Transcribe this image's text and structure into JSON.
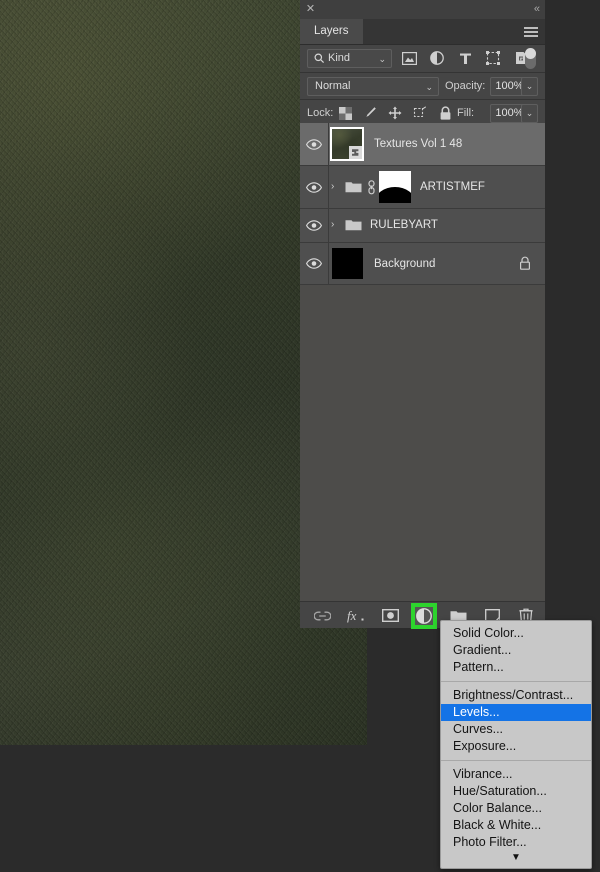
{
  "panel": {
    "close_icon": "close-icon",
    "collapse_icon": "collapse-icon",
    "tab_label": "Layers",
    "menu_icon": "panel-menu-icon"
  },
  "filter_row": {
    "kind_label": "Kind",
    "kind_arrow": "⌄",
    "icons": [
      {
        "name": "pixel-layer-filter-icon",
        "title": "Pixel layers"
      },
      {
        "name": "adjustment-layer-filter-icon",
        "title": "Adjustment layers"
      },
      {
        "name": "type-layer-filter-icon",
        "title": "Type layers"
      },
      {
        "name": "shape-layer-filter-icon",
        "title": "Shape layers"
      },
      {
        "name": "smart-object-filter-icon",
        "title": "Smart objects"
      }
    ],
    "toggle_name": "filter-enable-toggle"
  },
  "blend_row": {
    "blend_mode": "Normal",
    "blend_arrow": "⌄",
    "opacity_label": "Opacity:",
    "opacity_value": "100%",
    "opacity_arrow": "⌄"
  },
  "lock_row": {
    "lock_label": "Lock:",
    "icons": [
      {
        "name": "lock-transparent-pixels-icon"
      },
      {
        "name": "lock-image-pixels-icon"
      },
      {
        "name": "lock-position-icon"
      },
      {
        "name": "lock-artboard-nesting-icon"
      },
      {
        "name": "lock-all-icon"
      }
    ],
    "fill_label": "Fill:",
    "fill_value": "100%",
    "fill_arrow": "⌄"
  },
  "layers": [
    {
      "name": "Textures Vol 1 48",
      "selected": true,
      "type": "smart-object",
      "visible": true,
      "has_disclosure": false,
      "has_link": false,
      "has_mask": false,
      "locked": false
    },
    {
      "name": "ARTISTMEF",
      "selected": false,
      "type": "group",
      "visible": true,
      "has_disclosure": true,
      "has_link": true,
      "has_mask": true,
      "locked": false
    },
    {
      "name": "RULEBYART",
      "selected": false,
      "type": "group",
      "visible": true,
      "has_disclosure": true,
      "has_link": false,
      "has_mask": false,
      "locked": false
    },
    {
      "name": "Background",
      "selected": false,
      "type": "pixel",
      "visible": true,
      "has_disclosure": false,
      "has_link": false,
      "has_mask": false,
      "locked": true
    }
  ],
  "bottom_toolbar": [
    {
      "name": "link-layers-icon",
      "highlighted": false
    },
    {
      "name": "layer-style-fx-icon",
      "highlighted": false
    },
    {
      "name": "add-layer-mask-icon",
      "highlighted": false
    },
    {
      "name": "new-adjustment-layer-icon",
      "highlighted": true
    },
    {
      "name": "new-group-icon",
      "highlighted": false
    },
    {
      "name": "new-layer-icon",
      "highlighted": false
    },
    {
      "name": "delete-layer-icon",
      "highlighted": false
    }
  ],
  "adjustment_menu": {
    "groups": [
      [
        "Solid Color...",
        "Gradient...",
        "Pattern..."
      ],
      [
        "Brightness/Contrast...",
        "Levels...",
        "Curves...",
        "Exposure..."
      ],
      [
        "Vibrance...",
        "Hue/Saturation...",
        "Color Balance...",
        "Black & White...",
        "Photo Filter..."
      ]
    ],
    "highlighted_item": "Levels...",
    "scroll_arrow": "▼"
  },
  "colors": {
    "highlight_green": "#2dd42d",
    "menu_selection_blue": "#1473e6",
    "panel_background": "#3f3f3f",
    "layer_row": "#4f4f4f",
    "layer_row_selected": "#6b6b6b",
    "menu_background": "#c8c8c8",
    "app_background": "#2b2b2b"
  }
}
